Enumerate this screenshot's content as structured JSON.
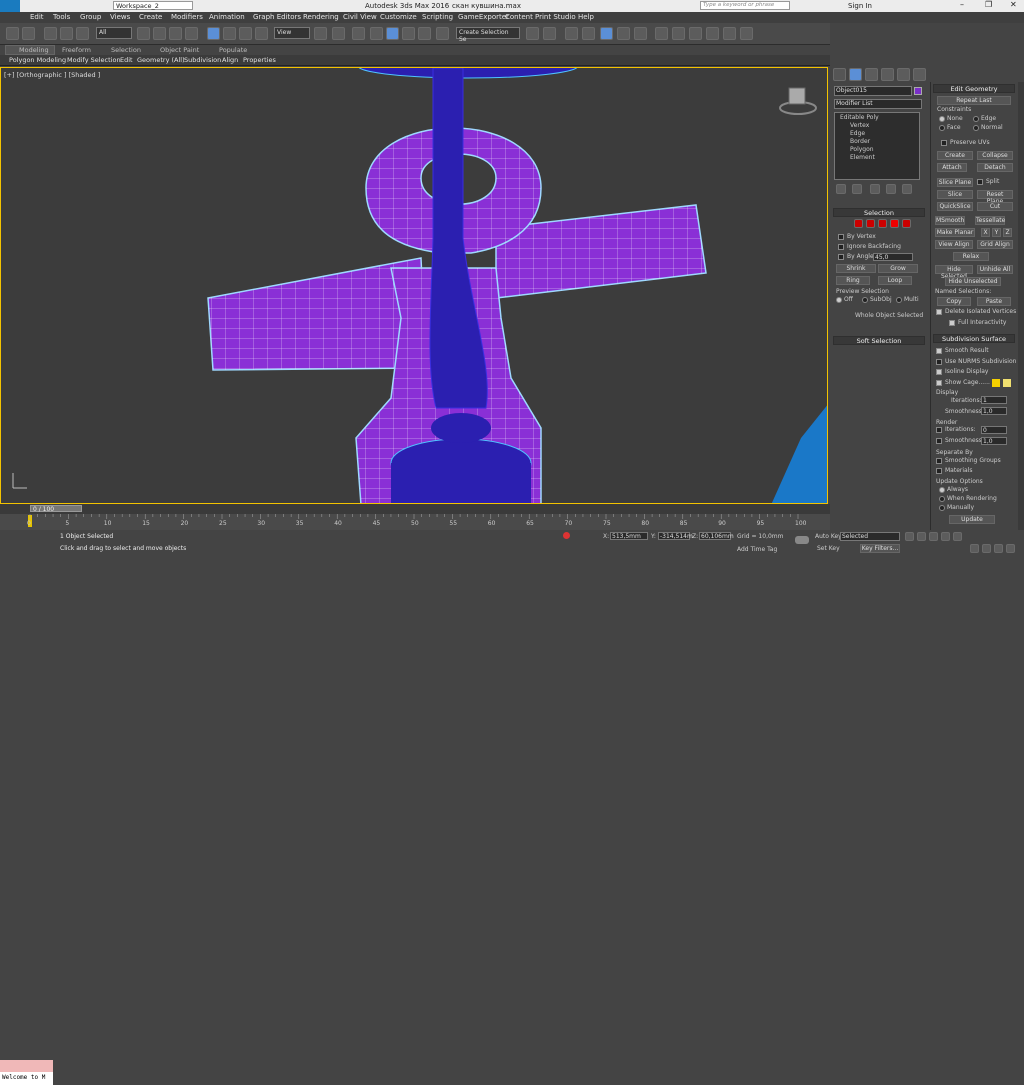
{
  "title": {
    "workspace": "Workspace_2",
    "app": "Autodesk 3ds Max 2016",
    "file": "скан кувшина.max",
    "search_placeholder": "Type a keyword or phrase",
    "sign_in": "Sign In"
  },
  "menu": [
    "Edit",
    "Tools",
    "Group",
    "Views",
    "Create",
    "Modifiers",
    "Animation",
    "Graph Editors",
    "Rendering",
    "Civil View",
    "Customize",
    "Scripting",
    "GameExporter",
    "Content",
    "Print Studio",
    "Help"
  ],
  "toolbar": {
    "filter": "All",
    "ref_coord": "View",
    "selection_set": "Create Selection Se"
  },
  "ribbon": {
    "tabs": [
      "Modeling",
      "Freeform",
      "Selection",
      "Object Paint",
      "Populate"
    ],
    "items": [
      "Polygon Modeling",
      "Modify Selection",
      "Edit",
      "Geometry (All)",
      "Subdivision",
      "Align",
      "Properties"
    ]
  },
  "viewport": {
    "label": "[+] [Orthographic ] [Shaded ]"
  },
  "modify": {
    "object_name": "Object015",
    "modifier_list": "Modifier List",
    "stack": [
      "Editable Poly",
      "Vertex",
      "Edge",
      "Border",
      "Polygon",
      "Element"
    ],
    "selection": {
      "title": "Selection",
      "by_vertex": "By Vertex",
      "ignore_backfacing": "Ignore Backfacing",
      "by_angle": "By Angle:",
      "angle": "45,0",
      "shrink": "Shrink",
      "grow": "Grow",
      "ring": "Ring",
      "loop": "Loop",
      "preview": "Preview Selection",
      "off": "Off",
      "subobj": "SubObj",
      "multi": "Multi",
      "status": "Whole Object Selected"
    },
    "soft_selection": "Soft Selection"
  },
  "edit_geometry": {
    "title": "Edit Geometry",
    "repeat_last": "Repeat Last",
    "constraints": "Constraints",
    "none": "None",
    "edge": "Edge",
    "face": "Face",
    "normal": "Normal",
    "preserve_uvs": "Preserve UVs",
    "create": "Create",
    "collapse": "Collapse",
    "attach": "Attach",
    "detach": "Detach",
    "slice_plane": "Slice Plane",
    "split": "Split",
    "slice": "Slice",
    "reset_plane": "Reset Plane",
    "quickslice": "QuickSlice",
    "cut": "Cut",
    "msmooth": "MSmooth",
    "tessellate": "Tessellate",
    "make_planar": "Make Planar",
    "x": "X",
    "y": "Y",
    "z": "Z",
    "view_align": "View Align",
    "grid_align": "Grid Align",
    "relax": "Relax",
    "hide_selected": "Hide Selected",
    "unhide_all": "Unhide All",
    "hide_unselected": "Hide Unselected",
    "named_selections": "Named Selections:",
    "copy": "Copy",
    "paste": "Paste",
    "delete_isolated": "Delete Isolated Vertices",
    "full_interactivity": "Full Interactivity"
  },
  "subdivision": {
    "title": "Subdivision Surface",
    "smooth_result": "Smooth Result",
    "use_nurms": "Use NURMS Subdivision",
    "isoline": "Isoline Display",
    "show_cage": "Show Cage......",
    "display": "Display",
    "iterations_label": "Iterations:",
    "iterations": "1",
    "smoothness_label": "Smoothness:",
    "smoothness": "1,0",
    "render": "Render",
    "r_iterations": "0",
    "r_smoothness": "1,0",
    "separate_by": "Separate By",
    "smoothing_groups": "Smoothing Groups",
    "materials": "Materials",
    "update_options": "Update Options",
    "always": "Always",
    "when_rendering": "When Rendering",
    "manually": "Manually",
    "update": "Update"
  },
  "timeline": {
    "frame": "0 / 100",
    "ticks": [
      "0",
      "5",
      "10",
      "15",
      "20",
      "25",
      "30",
      "35",
      "40",
      "45",
      "50",
      "55",
      "60",
      "65",
      "70",
      "75",
      "80",
      "85",
      "90",
      "95",
      "100"
    ]
  },
  "status": {
    "maxscript": "Welcome to M",
    "selected": "1 Object Selected",
    "prompt": "Click and drag to select and move objects",
    "x_label": "X:",
    "x": "513,5mm",
    "y_label": "Y:",
    "y": "-314,514m",
    "z_label": "Z:",
    "z": "60,106mm",
    "grid": "Grid = 10,0mm",
    "add_time_tag": "Add Time Tag",
    "auto_key": "Auto Key",
    "set_key": "Set Key",
    "selected_mode": "Selected",
    "key_filters": "Key Filters..."
  },
  "colors": {
    "object_purple": "#8a2fd6",
    "object_blue": "#2b1fb0",
    "viewport_bg": "#3c3c3c",
    "swatch": "#7a2fc8",
    "cage_yellow": "#f5d000"
  }
}
